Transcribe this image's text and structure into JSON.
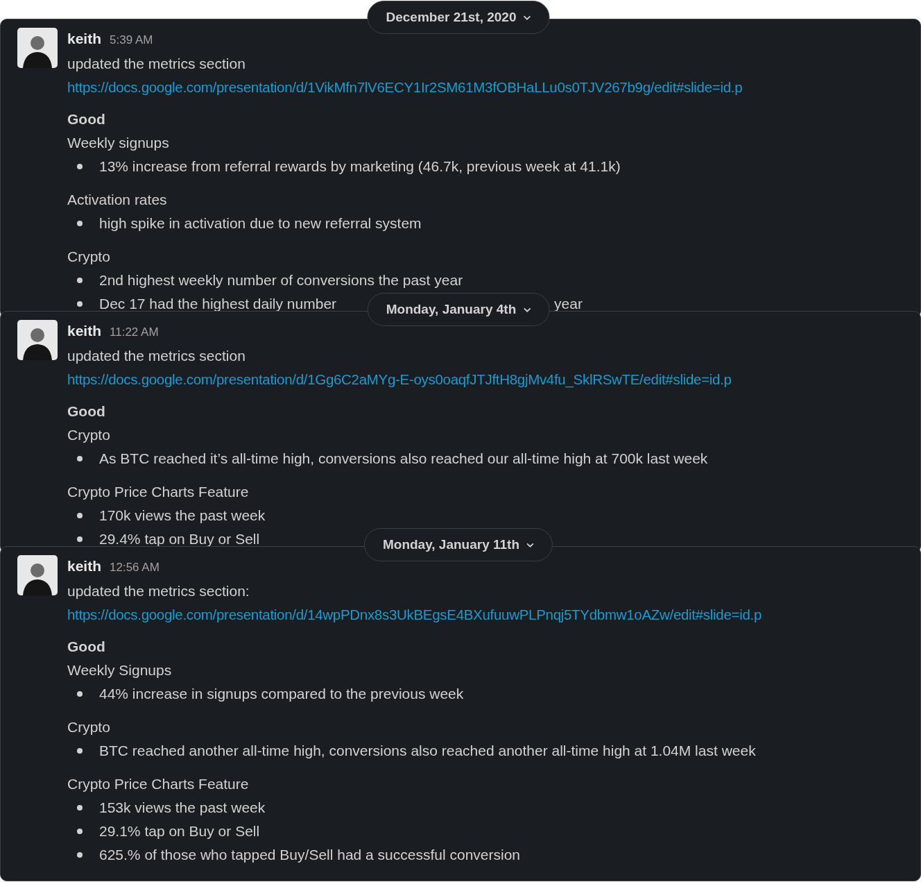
{
  "messages": [
    {
      "date": "December 21st, 2020",
      "author": "keith",
      "time": "5:39 AM",
      "text": "updated the metrics section",
      "link": "https://docs.google.com/presentation/d/1VikMfn7lV6ECY1Ir2SM61M3fOBHaLLu0s0TJV267b9g/edit#slide=id.p",
      "heading": "Good",
      "sections": [
        {
          "title": "Weekly signups",
          "bullets": [
            {
              "text": "13% increase from referral rewards by marketing (46.7k, previous week at 41.1k)"
            }
          ]
        },
        {
          "title": "Activation rates",
          "bullets": [
            {
              "text": "high spike in activation due to new referral system"
            }
          ]
        },
        {
          "title": "Crypto",
          "bullets": [
            {
              "text": "2nd highest weekly number of conversions the past year"
            },
            {
              "text": "Dec 17 had the highest daily number",
              "tail": "year"
            }
          ]
        }
      ]
    },
    {
      "date": "Monday, January 4th",
      "author": "keith",
      "time": "11:22 AM",
      "text": "updated the metrics section",
      "link": "https://docs.google.com/presentation/d/1Gg6C2aMYg-E-oys0oaqfJTJftH8gjMv4fu_SklRSwTE/edit#slide=id.p",
      "heading": "Good",
      "sections": [
        {
          "title": "Crypto",
          "bullets": [
            {
              "text": "As BTC reached it’s all-time high, conversions also reached our all-time high at 700k last week"
            }
          ]
        },
        {
          "title": "Crypto Price Charts Feature",
          "bullets": [
            {
              "text": "170k views the past week"
            },
            {
              "text": "29.4% tap on Buy or Sell"
            }
          ]
        }
      ]
    },
    {
      "date": "Monday, January 11th",
      "author": "keith",
      "time": "12:56 AM",
      "text": "updated the metrics section:",
      "link": "https://docs.google.com/presentation/d/14wpPDnx8s3UkBEgsE4BXufuuwPLPnqj5TYdbmw1oAZw/edit#slide=id.p",
      "heading": "Good",
      "sections": [
        {
          "title": "Weekly Signups",
          "bullets": [
            {
              "text": "44% increase in signups compared to the previous week"
            }
          ]
        },
        {
          "title": "Crypto",
          "bullets": [
            {
              "text": "BTC reached another all-time high, conversions also reached another all-time high at 1.04M last week"
            }
          ]
        },
        {
          "title": "Crypto Price Charts Feature",
          "bullets": [
            {
              "text": "153k views the past week"
            },
            {
              "text": "29.1% tap on Buy or Sell"
            },
            {
              "text": "625.% of those who tapped Buy/Sell had a successful conversion"
            }
          ]
        }
      ]
    }
  ]
}
